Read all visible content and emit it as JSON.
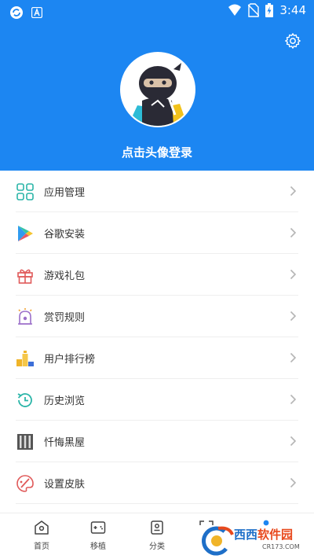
{
  "status_bar": {
    "time": "3:44"
  },
  "profile": {
    "login_prompt": "点击头像登录"
  },
  "menu": {
    "items": [
      {
        "label": "应用管理",
        "icon": "grid-apps-icon"
      },
      {
        "label": "谷歌安装",
        "icon": "google-play-icon"
      },
      {
        "label": "游戏礼包",
        "icon": "gift-icon"
      },
      {
        "label": "赏罚规则",
        "icon": "alarm-bell-icon"
      },
      {
        "label": "用户排行榜",
        "icon": "leaderboard-icon"
      },
      {
        "label": "历史浏览",
        "icon": "history-icon"
      },
      {
        "label": "忏悔黑屋",
        "icon": "jail-icon"
      },
      {
        "label": "设置皮肤",
        "icon": "palette-icon"
      }
    ]
  },
  "bottom_nav": {
    "items": [
      {
        "label": "首页",
        "icon": "home-icon"
      },
      {
        "label": "移植",
        "icon": "gamepad-icon"
      },
      {
        "label": "分类",
        "icon": "category-icon"
      }
    ]
  },
  "watermark": {
    "brand_part1": "西西",
    "brand_part2": "软件园",
    "url": "CR173.COM"
  },
  "colors": {
    "header": "#1c86f2",
    "accent": "#2bb5a8"
  }
}
